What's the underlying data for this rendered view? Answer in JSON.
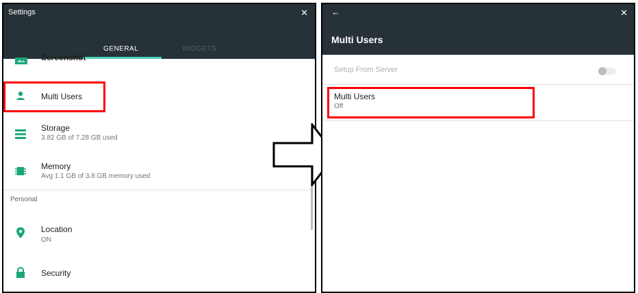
{
  "left": {
    "title": "Settings",
    "close_icon": "✕",
    "tabs": [
      {
        "label": "GENERAL",
        "active": true
      },
      {
        "label": "WIDGETS",
        "active": false
      }
    ],
    "items": [
      {
        "label": "Screenshot",
        "icon": "screenshot-icon"
      },
      {
        "label": "Multi Users",
        "icon": "person-icon"
      },
      {
        "label": "Storage",
        "sub": "3.82 GB of 7.28 GB used",
        "icon": "storage-icon"
      },
      {
        "label": "Memory",
        "sub": "Avg 1.1 GB of 3.8 GB memory used",
        "icon": "memory-icon"
      }
    ],
    "section_personal": "Personal",
    "personal_items": [
      {
        "label": "Location",
        "sub": "ON",
        "icon": "location-icon"
      },
      {
        "label": "Security",
        "icon": "lock-icon"
      }
    ]
  },
  "right": {
    "back_icon": "←",
    "close_icon": "✕",
    "title": "Multi Users",
    "rows": [
      {
        "label": "Setup From Server",
        "toggle": "off",
        "disabled": true
      },
      {
        "label": "Multi Users",
        "sub": "Off"
      }
    ]
  },
  "colors": {
    "topbar": "#263238",
    "accent": "#4fd0c0",
    "icon_green": "#1aa57a",
    "highlight": "#ff0000"
  }
}
